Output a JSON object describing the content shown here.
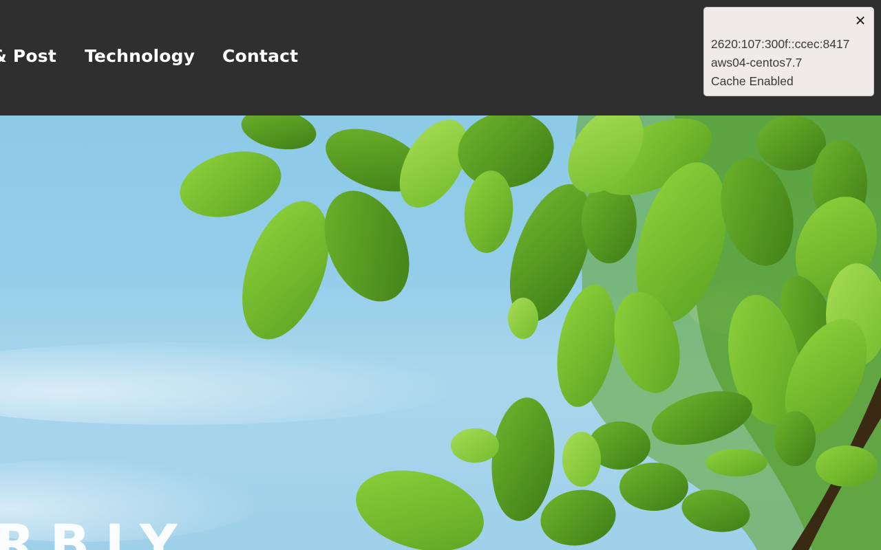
{
  "nav": {
    "items": [
      {
        "label": "& Post"
      },
      {
        "label": "Technology"
      },
      {
        "label": "Contact"
      }
    ]
  },
  "hero": {
    "overlay_text": "RBIY",
    "image": "green-leaves-against-blue-sky"
  },
  "server_info": {
    "close_icon": "✕",
    "lines": [
      "2620:107:300f::ccec:8417",
      "aws04-centos7.7",
      "Cache Enabled"
    ]
  },
  "colors": {
    "header_bg": "#2f2f2f",
    "sky": "#8ccae8",
    "leaf": "#6fb82a",
    "info_bg": "#efebea"
  }
}
